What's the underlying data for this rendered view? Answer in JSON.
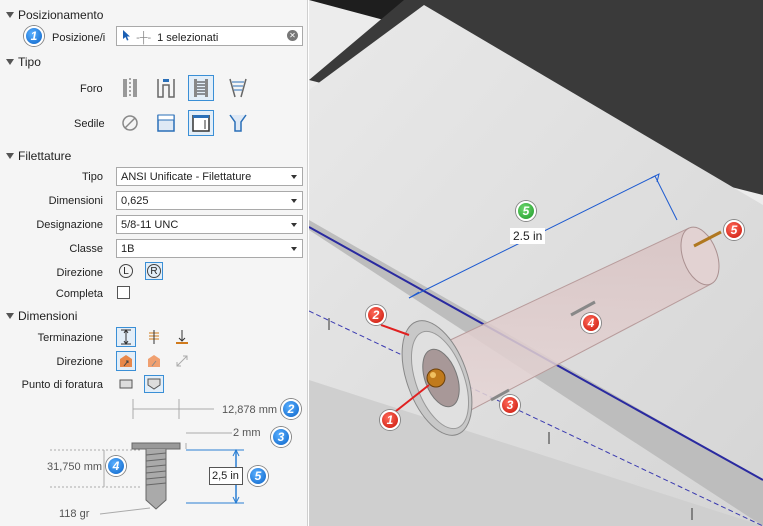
{
  "panel": {
    "positioning": {
      "title": "Posizionamento",
      "positions_label": "Posizione/i",
      "selection_value": "1 selezionati",
      "badge": "1"
    },
    "type": {
      "title": "Tipo",
      "hole_label": "Foro",
      "seat_label": "Sedile"
    },
    "threads": {
      "title": "Filettature",
      "type_label": "Tipo",
      "type_value": "ANSI Unificate - Filettature",
      "size_label": "Dimensioni",
      "size_value": "0,625",
      "designation_label": "Designazione",
      "designation_value": "5/8-11 UNC",
      "class_label": "Classe",
      "class_value": "1B",
      "direction_label": "Direzione",
      "direction_left": "L",
      "direction_right": "R",
      "full_label": "Completa",
      "full_checked": false
    },
    "dimensions": {
      "title": "Dimensioni",
      "termination_label": "Terminazione",
      "direction_label": "Direzione",
      "drill_point_label": "Punto di foratura",
      "diagram": {
        "top_dim": "12,878 mm",
        "top_badge": "2",
        "offset_dim": "2 mm",
        "offset_badge": "3",
        "thread_dim": "31,750 mm",
        "thread_badge": "4",
        "depth_value": "2,5 in",
        "depth_badge": "5",
        "angle": "118 gr"
      }
    }
  },
  "viewport": {
    "dimension_label": "2.5 in",
    "badges": {
      "green": "5",
      "r1": "1",
      "r2": "2",
      "r3": "3",
      "r4": "4",
      "r5": "5"
    }
  }
}
